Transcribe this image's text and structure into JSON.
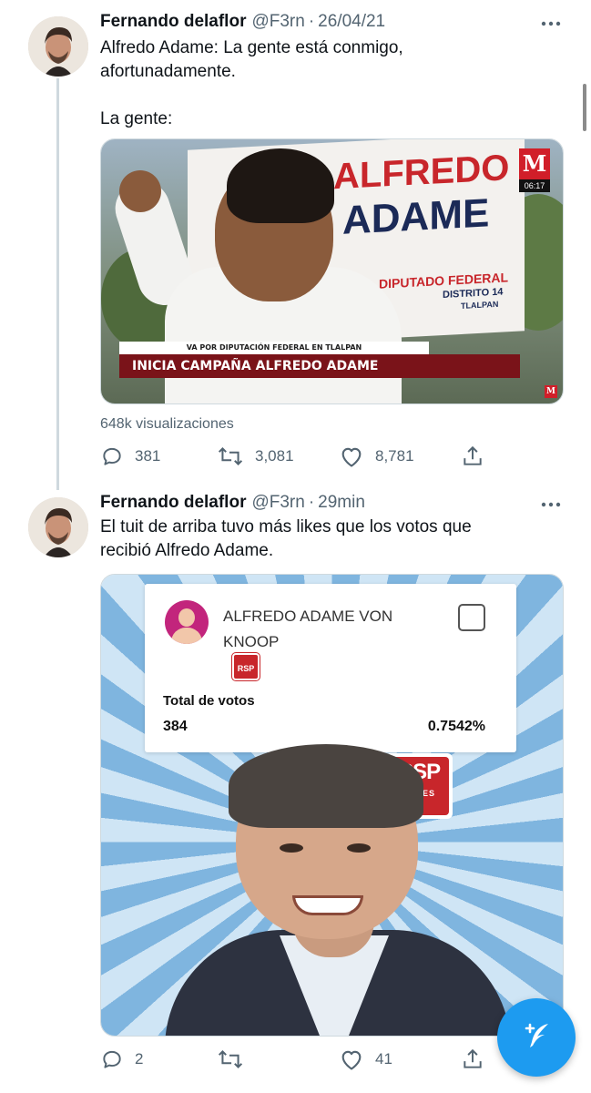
{
  "tweets": [
    {
      "author_name": "Fernando delaflor",
      "handle": "@F3rn",
      "separator": "·",
      "timestamp": "26/04/21",
      "text": "Alfredo Adame: La gente está conmigo,\nafortunadamente.\n\nLa gente:",
      "media": {
        "banner_line1": "ALFREDO",
        "banner_line2": "ADAME",
        "banner_line3": "DIPUTADO FEDERAL",
        "banner_line4": "DISTRITO 14",
        "banner_line5": "TLALPAN",
        "channel_logo": "M",
        "channel_time": "06:17",
        "ticker_top": "VA POR DIPUTACIÓN FEDERAL EN TLALPAN",
        "ticker_main": "INICIA CAMPAÑA ALFREDO ADAME"
      },
      "views": "648k visualizaciones",
      "replies": "381",
      "retweets": "3,081",
      "likes": "8,781"
    },
    {
      "author_name": "Fernando delaflor",
      "handle": "@F3rn",
      "separator": "·",
      "timestamp": "29min",
      "text": "El tuit de arriba tuvo más likes que los votos que\nrecibió Alfredo Adame.",
      "media": {
        "candidate_name": "ALFREDO ADAME VON KNOOP",
        "party_abbr": "RSP",
        "party_sub": "REDES",
        "votes_label": "Total de votos",
        "votes_count": "384",
        "votes_percent": "0.7542%"
      },
      "replies": "2",
      "retweets": "",
      "likes": "41"
    }
  ],
  "icons": {
    "reply": "reply-icon",
    "retweet": "retweet-icon",
    "like": "heart-icon",
    "share": "share-icon",
    "more": "more-icon",
    "compose": "compose-icon"
  },
  "colors": {
    "accent": "#1d9bf0",
    "secondary_text": "#536471",
    "party_red": "#c8262b"
  }
}
